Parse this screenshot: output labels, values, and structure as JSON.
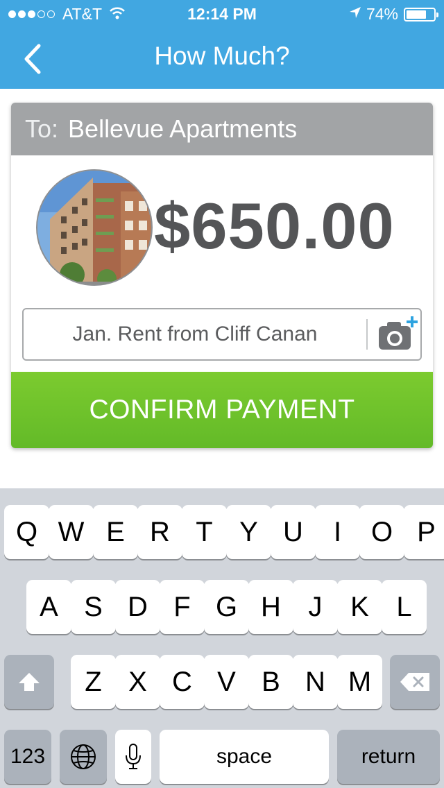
{
  "status_bar": {
    "carrier": "AT&T",
    "signal_bars_filled": 3,
    "signal_bars_total": 5,
    "time": "12:14 PM",
    "battery_percent": "74%",
    "battery_level": 0.74,
    "icons": [
      "signal-dots-icon",
      "wifi-icon",
      "location-arrow-icon",
      "battery-icon"
    ]
  },
  "nav": {
    "title": "How Much?",
    "back_icon": "chevron-left-icon"
  },
  "payment": {
    "to_label": "To:",
    "recipient": "Bellevue Apartments",
    "amount": "$650.00",
    "memo_value": "Jan. Rent from Cliff Canan",
    "camera_icon": "camera-add-icon",
    "confirm_label": "CONFIRM PAYMENT"
  },
  "keyboard": {
    "rows": [
      [
        "Q",
        "W",
        "E",
        "R",
        "T",
        "Y",
        "U",
        "I",
        "O",
        "P"
      ],
      [
        "A",
        "S",
        "D",
        "F",
        "G",
        "H",
        "J",
        "K",
        "L"
      ],
      [
        "Z",
        "X",
        "C",
        "V",
        "B",
        "N",
        "M"
      ]
    ],
    "numbers_label": "123",
    "space_label": "space",
    "return_label": "return",
    "icons": [
      "shift-icon",
      "delete-icon",
      "globe-icon",
      "microphone-icon"
    ]
  },
  "colors": {
    "header_blue": "#41a7e1",
    "to_bar_gray": "#a2a4a6",
    "confirm_green": "#6cc22c",
    "amount_gray": "#545557",
    "keyboard_bg": "#d1d5db"
  }
}
